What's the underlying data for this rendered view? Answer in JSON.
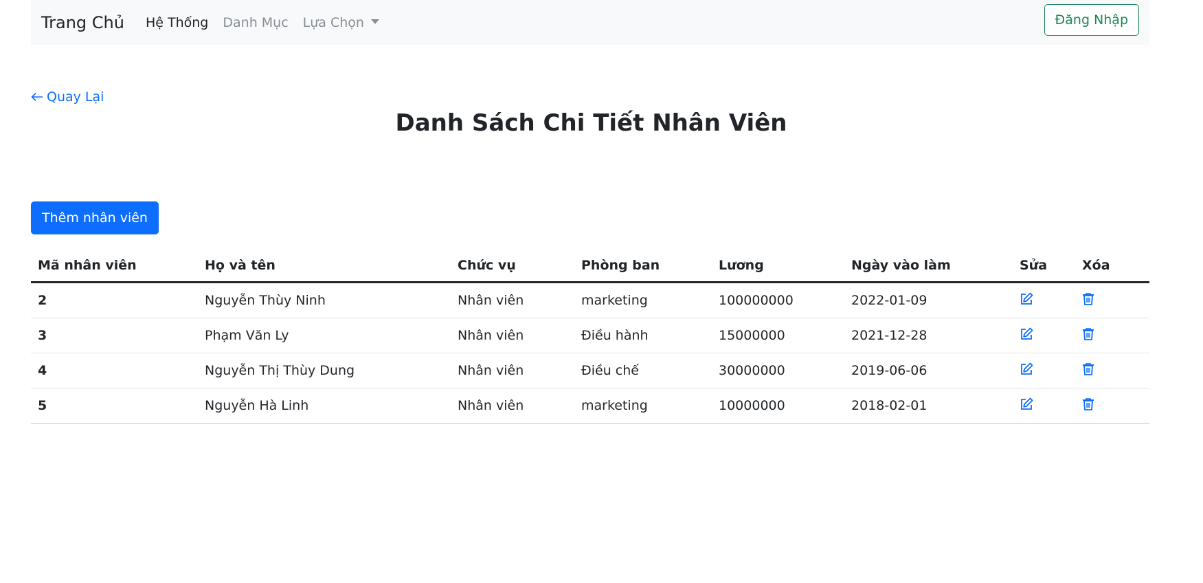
{
  "navbar": {
    "brand": "Trang Chủ",
    "items": [
      {
        "label": "Hệ Thống"
      },
      {
        "label": "Danh Mục"
      },
      {
        "label": "Lựa Chọn"
      }
    ],
    "login_label": "Đăng Nhập"
  },
  "back_link": "Quay Lại",
  "page_title": "Danh Sách Chi Tiết Nhân Viên",
  "add_button": "Thêm nhân viên",
  "table": {
    "headers": [
      "Mã nhân viên",
      "Họ và tên",
      "Chức vụ",
      "Phòng ban",
      "Lương",
      "Ngày vào làm",
      "Sửa",
      "Xóa"
    ],
    "rows": [
      {
        "id": "2",
        "name": "Nguyễn Thùy Ninh",
        "position": "Nhân viên",
        "department": "marketing",
        "salary": "100000000",
        "start_date": "2022-01-09"
      },
      {
        "id": "3",
        "name": "Phạm Văn Ly",
        "position": "Nhân viên",
        "department": "Điều hành",
        "salary": "15000000",
        "start_date": "2021-12-28"
      },
      {
        "id": "4",
        "name": "Nguyễn Thị Thùy Dung",
        "position": "Nhân viên",
        "department": "Điều chế",
        "salary": "30000000",
        "start_date": "2019-06-06"
      },
      {
        "id": "5",
        "name": "Nguyễn Hà Linh",
        "position": "Nhân viên",
        "department": "marketing",
        "salary": "10000000",
        "start_date": "2018-02-01"
      }
    ]
  },
  "icons": {
    "edit": "edit-icon",
    "delete": "trash-icon",
    "back": "arrow-left-icon"
  },
  "colors": {
    "primary": "#0d6efd",
    "success": "#198754",
    "navbar_bg": "#f8f9fa"
  }
}
